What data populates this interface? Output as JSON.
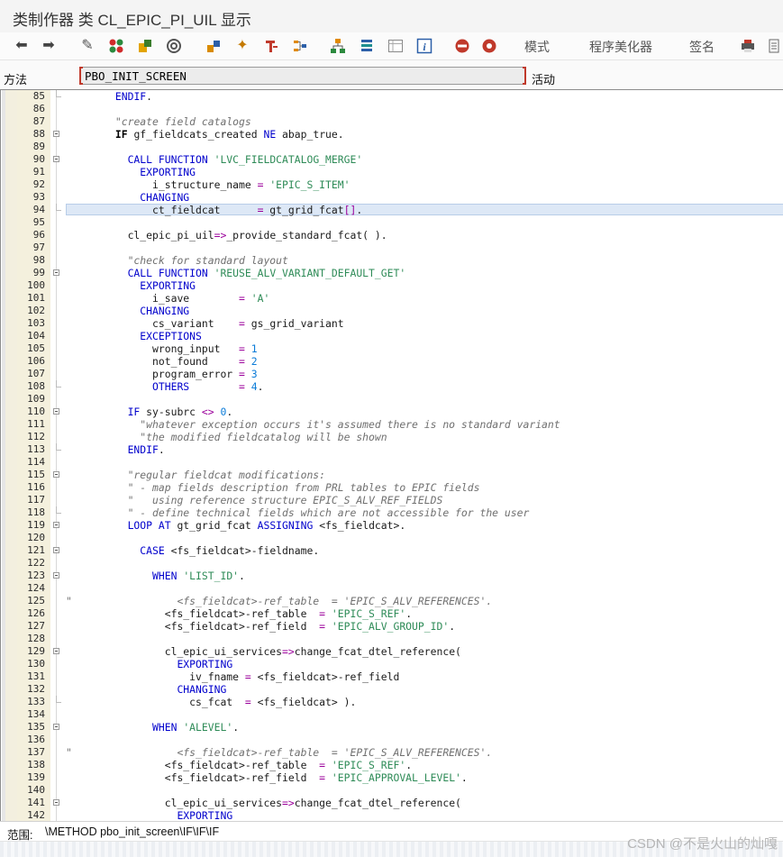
{
  "window": {
    "title": "类制作器 类 CL_EPIC_PI_UIL 显示"
  },
  "toolbar": {
    "icons": [
      "back-arrow-icon",
      "forward-arrow-icon",
      "display-change-icon",
      "object-switch-icon",
      "activate-icon",
      "check-icon",
      "test-icon",
      "where-used-icon",
      "magic-wand-icon",
      "insert-icon",
      "method-nav-icon",
      "hierarchy-icon",
      "object-list-icon",
      "table-view-icon",
      "info-icon",
      "breakpoint-session-icon",
      "breakpoint-external-icon",
      "print-icon",
      "more-icon"
    ],
    "pattern_label": "模式",
    "pretty_printer_label": "程序美化器",
    "signature_label": "签名"
  },
  "method_row": {
    "label": "方法",
    "value": "PBO_INIT_SCREEN",
    "status": "活动"
  },
  "editor": {
    "highlighted_line": "94",
    "lines": [
      {
        "n": "85",
        "fold": "end",
        "code": [
          [
            "        ",
            ""
          ],
          [
            "ENDIF",
            "kw"
          ],
          [
            ".",
            ""
          ]
        ]
      },
      {
        "n": "86",
        "fold": "",
        "code": []
      },
      {
        "n": "87",
        "fold": "",
        "code": [
          [
            "        ",
            ""
          ],
          [
            "\"create field catalogs",
            "cmt"
          ]
        ]
      },
      {
        "n": "88",
        "fold": "box",
        "code": [
          [
            "        ",
            ""
          ],
          [
            "IF",
            "bold"
          ],
          [
            " gf_fieldcats_created ",
            ""
          ],
          [
            "NE",
            "kw"
          ],
          [
            " abap_true.",
            ""
          ]
        ]
      },
      {
        "n": "89",
        "fold": "",
        "code": []
      },
      {
        "n": "90",
        "fold": "box",
        "code": [
          [
            "          ",
            ""
          ],
          [
            "CALL FUNCTION",
            "kw"
          ],
          [
            " ",
            ""
          ],
          [
            "'LVC_FIELDCATALOG_MERGE'",
            "str"
          ]
        ]
      },
      {
        "n": "91",
        "fold": "",
        "code": [
          [
            "            ",
            ""
          ],
          [
            "EXPORTING",
            "kw"
          ]
        ]
      },
      {
        "n": "92",
        "fold": "",
        "code": [
          [
            "              i_structure_name ",
            ""
          ],
          [
            "=",
            "op"
          ],
          [
            " ",
            ""
          ],
          [
            "'EPIC_S_ITEM'",
            "str"
          ]
        ]
      },
      {
        "n": "93",
        "fold": "",
        "code": [
          [
            "            ",
            ""
          ],
          [
            "CHANGING",
            "kw"
          ]
        ]
      },
      {
        "n": "94",
        "fold": "end",
        "code": [
          [
            "              ct_fieldcat      ",
            ""
          ],
          [
            "=",
            "op"
          ],
          [
            " gt_grid_fcat",
            ""
          ],
          [
            "[]",
            "op"
          ],
          [
            ".",
            ""
          ]
        ]
      },
      {
        "n": "95",
        "fold": "",
        "code": []
      },
      {
        "n": "96",
        "fold": "",
        "code": [
          [
            "          cl_epic_pi_uil",
            ""
          ],
          [
            "=>",
            "op"
          ],
          [
            "_provide_standard_fcat( ).",
            ""
          ]
        ]
      },
      {
        "n": "97",
        "fold": "",
        "code": []
      },
      {
        "n": "98",
        "fold": "",
        "code": [
          [
            "          ",
            ""
          ],
          [
            "\"check for standard layout",
            "cmt"
          ]
        ]
      },
      {
        "n": "99",
        "fold": "box",
        "code": [
          [
            "          ",
            ""
          ],
          [
            "CALL FUNCTION",
            "kw"
          ],
          [
            " ",
            ""
          ],
          [
            "'REUSE_ALV_VARIANT_DEFAULT_GET'",
            "str"
          ]
        ]
      },
      {
        "n": "100",
        "fold": "",
        "code": [
          [
            "            ",
            ""
          ],
          [
            "EXPORTING",
            "kw"
          ]
        ]
      },
      {
        "n": "101",
        "fold": "",
        "code": [
          [
            "              i_save        ",
            ""
          ],
          [
            "=",
            "op"
          ],
          [
            " ",
            ""
          ],
          [
            "'A'",
            "str"
          ]
        ]
      },
      {
        "n": "102",
        "fold": "",
        "code": [
          [
            "            ",
            ""
          ],
          [
            "CHANGING",
            "kw"
          ]
        ]
      },
      {
        "n": "103",
        "fold": "",
        "code": [
          [
            "              cs_variant    ",
            ""
          ],
          [
            "=",
            "op"
          ],
          [
            " gs_grid_variant",
            ""
          ]
        ]
      },
      {
        "n": "104",
        "fold": "",
        "code": [
          [
            "            ",
            ""
          ],
          [
            "EXCEPTIONS",
            "kw"
          ]
        ]
      },
      {
        "n": "105",
        "fold": "",
        "code": [
          [
            "              wrong_input   ",
            ""
          ],
          [
            "=",
            "op"
          ],
          [
            " ",
            ""
          ],
          [
            "1",
            "num"
          ]
        ]
      },
      {
        "n": "106",
        "fold": "",
        "code": [
          [
            "              not_found     ",
            ""
          ],
          [
            "=",
            "op"
          ],
          [
            " ",
            ""
          ],
          [
            "2",
            "num"
          ]
        ]
      },
      {
        "n": "107",
        "fold": "",
        "code": [
          [
            "              program_error ",
            ""
          ],
          [
            "=",
            "op"
          ],
          [
            " ",
            ""
          ],
          [
            "3",
            "num"
          ]
        ]
      },
      {
        "n": "108",
        "fold": "end",
        "code": [
          [
            "              ",
            ""
          ],
          [
            "OTHERS",
            "kw"
          ],
          [
            "        ",
            ""
          ],
          [
            "=",
            "op"
          ],
          [
            " ",
            ""
          ],
          [
            "4",
            "num"
          ],
          [
            ".",
            ""
          ]
        ]
      },
      {
        "n": "109",
        "fold": "",
        "code": []
      },
      {
        "n": "110",
        "fold": "box",
        "code": [
          [
            "          ",
            ""
          ],
          [
            "IF",
            "kw"
          ],
          [
            " sy-subrc ",
            ""
          ],
          [
            "<>",
            "op"
          ],
          [
            " ",
            ""
          ],
          [
            "0",
            "num"
          ],
          [
            ".",
            ""
          ]
        ]
      },
      {
        "n": "111",
        "fold": "",
        "code": [
          [
            "            ",
            ""
          ],
          [
            "\"whatever exception occurs it's assumed there is no standard variant",
            "cmt"
          ]
        ]
      },
      {
        "n": "112",
        "fold": "",
        "code": [
          [
            "            ",
            ""
          ],
          [
            "\"the modified fieldcatalog will be shown",
            "cmt"
          ]
        ]
      },
      {
        "n": "113",
        "fold": "end",
        "code": [
          [
            "          ",
            ""
          ],
          [
            "ENDIF",
            "kw"
          ],
          [
            ".",
            ""
          ]
        ]
      },
      {
        "n": "114",
        "fold": "",
        "code": []
      },
      {
        "n": "115",
        "fold": "box",
        "code": [
          [
            "          ",
            ""
          ],
          [
            "\"regular fieldcat modifications:",
            "cmt"
          ]
        ]
      },
      {
        "n": "116",
        "fold": "",
        "code": [
          [
            "          ",
            ""
          ],
          [
            "\" - map fields description from PRL tables to EPIC fields",
            "cmt"
          ]
        ]
      },
      {
        "n": "117",
        "fold": "",
        "code": [
          [
            "          ",
            ""
          ],
          [
            "\"   using reference structure EPIC_S_ALV_REF_FIELDS",
            "cmt"
          ]
        ]
      },
      {
        "n": "118",
        "fold": "end",
        "code": [
          [
            "          ",
            ""
          ],
          [
            "\" - define technical fields which are not accessible for the user",
            "cmt"
          ]
        ]
      },
      {
        "n": "119",
        "fold": "box",
        "code": [
          [
            "          ",
            ""
          ],
          [
            "LOOP AT",
            "kw"
          ],
          [
            " gt_grid_fcat ",
            ""
          ],
          [
            "ASSIGNING",
            "kw"
          ],
          [
            " <fs_fieldcat>.",
            ""
          ]
        ]
      },
      {
        "n": "120",
        "fold": "",
        "code": []
      },
      {
        "n": "121",
        "fold": "box",
        "code": [
          [
            "            ",
            ""
          ],
          [
            "CASE",
            "kw"
          ],
          [
            " <fs_fieldcat>-fieldname.",
            ""
          ]
        ]
      },
      {
        "n": "122",
        "fold": "",
        "code": []
      },
      {
        "n": "123",
        "fold": "box",
        "code": [
          [
            "              ",
            ""
          ],
          [
            "WHEN",
            "kw"
          ],
          [
            " ",
            ""
          ],
          [
            "'LIST_ID'",
            "str"
          ],
          [
            ".",
            ""
          ]
        ]
      },
      {
        "n": "124",
        "fold": "",
        "code": []
      },
      {
        "n": "125",
        "fold": "",
        "code": [
          [
            "",
            ""
          ],
          [
            "\"                 <fs_fieldcat>-ref_table  = 'EPIC_S_ALV_REFERENCES'.",
            "cmt"
          ]
        ]
      },
      {
        "n": "126",
        "fold": "",
        "code": [
          [
            "                <fs_fieldcat>-ref_table  ",
            ""
          ],
          [
            "=",
            "op"
          ],
          [
            " ",
            ""
          ],
          [
            "'EPIC_S_REF'",
            "str"
          ],
          [
            ".",
            ""
          ]
        ]
      },
      {
        "n": "127",
        "fold": "",
        "code": [
          [
            "                <fs_fieldcat>-ref_field  ",
            ""
          ],
          [
            "=",
            "op"
          ],
          [
            " ",
            ""
          ],
          [
            "'EPIC_ALV_GROUP_ID'",
            "str"
          ],
          [
            ".",
            ""
          ]
        ]
      },
      {
        "n": "128",
        "fold": "",
        "code": []
      },
      {
        "n": "129",
        "fold": "box",
        "code": [
          [
            "                cl_epic_ui_services",
            ""
          ],
          [
            "=>",
            "op"
          ],
          [
            "change_fcat_dtel_reference(",
            ""
          ]
        ]
      },
      {
        "n": "130",
        "fold": "",
        "code": [
          [
            "                  ",
            ""
          ],
          [
            "EXPORTING",
            "kw"
          ]
        ]
      },
      {
        "n": "131",
        "fold": "",
        "code": [
          [
            "                    iv_fname ",
            ""
          ],
          [
            "=",
            "op"
          ],
          [
            " <fs_fieldcat>-ref_field",
            ""
          ]
        ]
      },
      {
        "n": "132",
        "fold": "",
        "code": [
          [
            "                  ",
            ""
          ],
          [
            "CHANGING",
            "kw"
          ]
        ]
      },
      {
        "n": "133",
        "fold": "end",
        "code": [
          [
            "                    cs_fcat  ",
            ""
          ],
          [
            "=",
            "op"
          ],
          [
            " <fs_fieldcat> ).",
            ""
          ]
        ]
      },
      {
        "n": "134",
        "fold": "",
        "code": []
      },
      {
        "n": "135",
        "fold": "box",
        "code": [
          [
            "              ",
            ""
          ],
          [
            "WHEN",
            "kw"
          ],
          [
            " ",
            ""
          ],
          [
            "'ALEVEL'",
            "str"
          ],
          [
            ".",
            ""
          ]
        ]
      },
      {
        "n": "136",
        "fold": "",
        "code": []
      },
      {
        "n": "137",
        "fold": "",
        "code": [
          [
            "",
            ""
          ],
          [
            "\"                 <fs_fieldcat>-ref_table  = 'EPIC_S_ALV_REFERENCES'.",
            "cmt"
          ]
        ]
      },
      {
        "n": "138",
        "fold": "",
        "code": [
          [
            "                <fs_fieldcat>-ref_table  ",
            ""
          ],
          [
            "=",
            "op"
          ],
          [
            " ",
            ""
          ],
          [
            "'EPIC_S_REF'",
            "str"
          ],
          [
            ".",
            ""
          ]
        ]
      },
      {
        "n": "139",
        "fold": "",
        "code": [
          [
            "                <fs_fieldcat>-ref_field  ",
            ""
          ],
          [
            "=",
            "op"
          ],
          [
            " ",
            ""
          ],
          [
            "'EPIC_APPROVAL_LEVEL'",
            "str"
          ],
          [
            ".",
            ""
          ]
        ]
      },
      {
        "n": "140",
        "fold": "",
        "code": []
      },
      {
        "n": "141",
        "fold": "box",
        "code": [
          [
            "                cl_epic_ui_services",
            ""
          ],
          [
            "=>",
            "op"
          ],
          [
            "change_fcat_dtel_reference(",
            ""
          ]
        ]
      },
      {
        "n": "142",
        "fold": "",
        "code": [
          [
            "                  ",
            ""
          ],
          [
            "EXPORTING",
            "kw"
          ]
        ]
      }
    ]
  },
  "statusbar": {
    "scope_label": "范围:",
    "scope_value": "\\METHOD pbo_init_screen\\IF\\IF\\IF"
  },
  "watermark": "CSDN @不是火山的灿嘎",
  "colors": {
    "keyword": "#0000cc",
    "string": "#2e8b57",
    "number": "#0a7bd8",
    "comment": "#707070",
    "highlight": "#dde8f6"
  }
}
